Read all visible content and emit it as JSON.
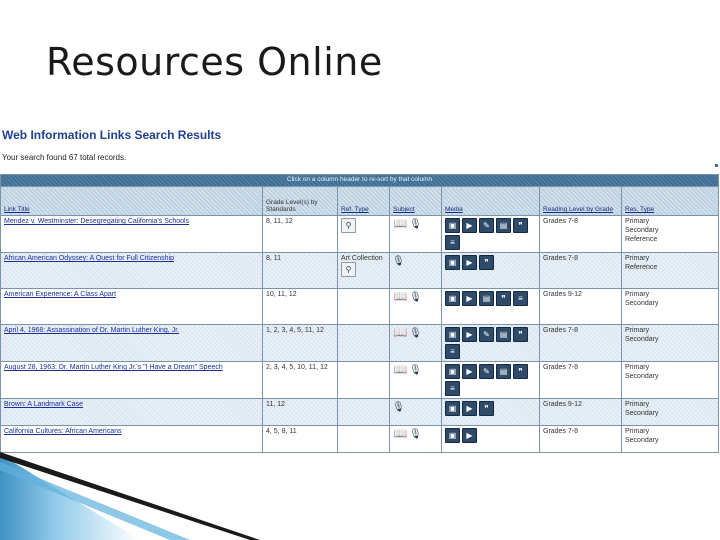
{
  "slide": {
    "title": "Resources Online"
  },
  "results": {
    "title": "Web Information Links Search Results",
    "count_text": "Your search found 67 total records.",
    "banner": "Click on a column header to re-sort by that column"
  },
  "columns": {
    "link_title": "Link Title",
    "grade_levels": "Grade Level(s) by Standards",
    "ref_type": "Ref. Type",
    "subject": "Subject",
    "media": "Media",
    "reading_level": "Reading Level by Grade",
    "res_type": "Res. Type"
  },
  "rows": [
    {
      "title": "Mendez v. Westminster: Desegregating California's Schools",
      "grades": "8, 11, 12",
      "ref": "",
      "ref_icon": "reference-icon",
      "reading": "Grades 7-8",
      "res": [
        "Primary",
        "Secondary",
        "Reference"
      ]
    },
    {
      "title": "African American Odyssey: A Quest for Full Citizenship",
      "grades": "8, 11",
      "ref": "Art Collection",
      "ref_icon": "reference-icon",
      "reading": "Grades 7-8",
      "res": [
        "Primary",
        "Reference"
      ]
    },
    {
      "title": "American Experience: A Class Apart",
      "grades": "10, 11, 12",
      "ref": "",
      "ref_icon": "",
      "reading": "Grades 9-12",
      "res": [
        "Primary",
        "Secondary"
      ]
    },
    {
      "title": "April 4, 1968: Assassination of Dr. Martin Luther King, Jr.",
      "grades": "1, 2, 3, 4, 5, 11, 12",
      "ref": "",
      "ref_icon": "",
      "reading": "Grades 7-8",
      "res": [
        "Primary",
        "Secondary"
      ]
    },
    {
      "title": "August 28, 1963: Dr. Martin Luther King Jr.'s \"I Have a Dream\" Speech",
      "grades": "2, 3, 4, 5, 10, 11, 12",
      "ref": "",
      "ref_icon": "",
      "reading": "Grades 7-8",
      "res": [
        "Primary",
        "Secondary"
      ]
    },
    {
      "title": "Brown: A Landmark Case",
      "grades": "11, 12",
      "ref": "",
      "ref_icon": "",
      "reading": "Grades 9-12",
      "res": [
        "Primary",
        "Secondary"
      ]
    },
    {
      "title": "California Cultures: African Americans",
      "grades": "4, 5, 8, 11",
      "ref": "",
      "ref_icon": "",
      "reading": "Grades 7-8",
      "res": [
        "Primary",
        "Secondary"
      ]
    }
  ],
  "icons": {
    "subject_book": "book-icon",
    "subject_mic": "microphone-icon",
    "media_camera": "camera-icon",
    "media_video": "video-icon",
    "media_pencil": "pencil-icon",
    "media_film": "film-icon",
    "media_chat": "speech-icon",
    "media_doc": "document-icon"
  },
  "colors": {
    "banner": "#3f6f94",
    "header": "#bcd1e2",
    "alt_row": "#dce7f1",
    "link": "#1c2f9a",
    "title": "#1f3f8f",
    "accent_stripe": "#1e7fb8"
  }
}
